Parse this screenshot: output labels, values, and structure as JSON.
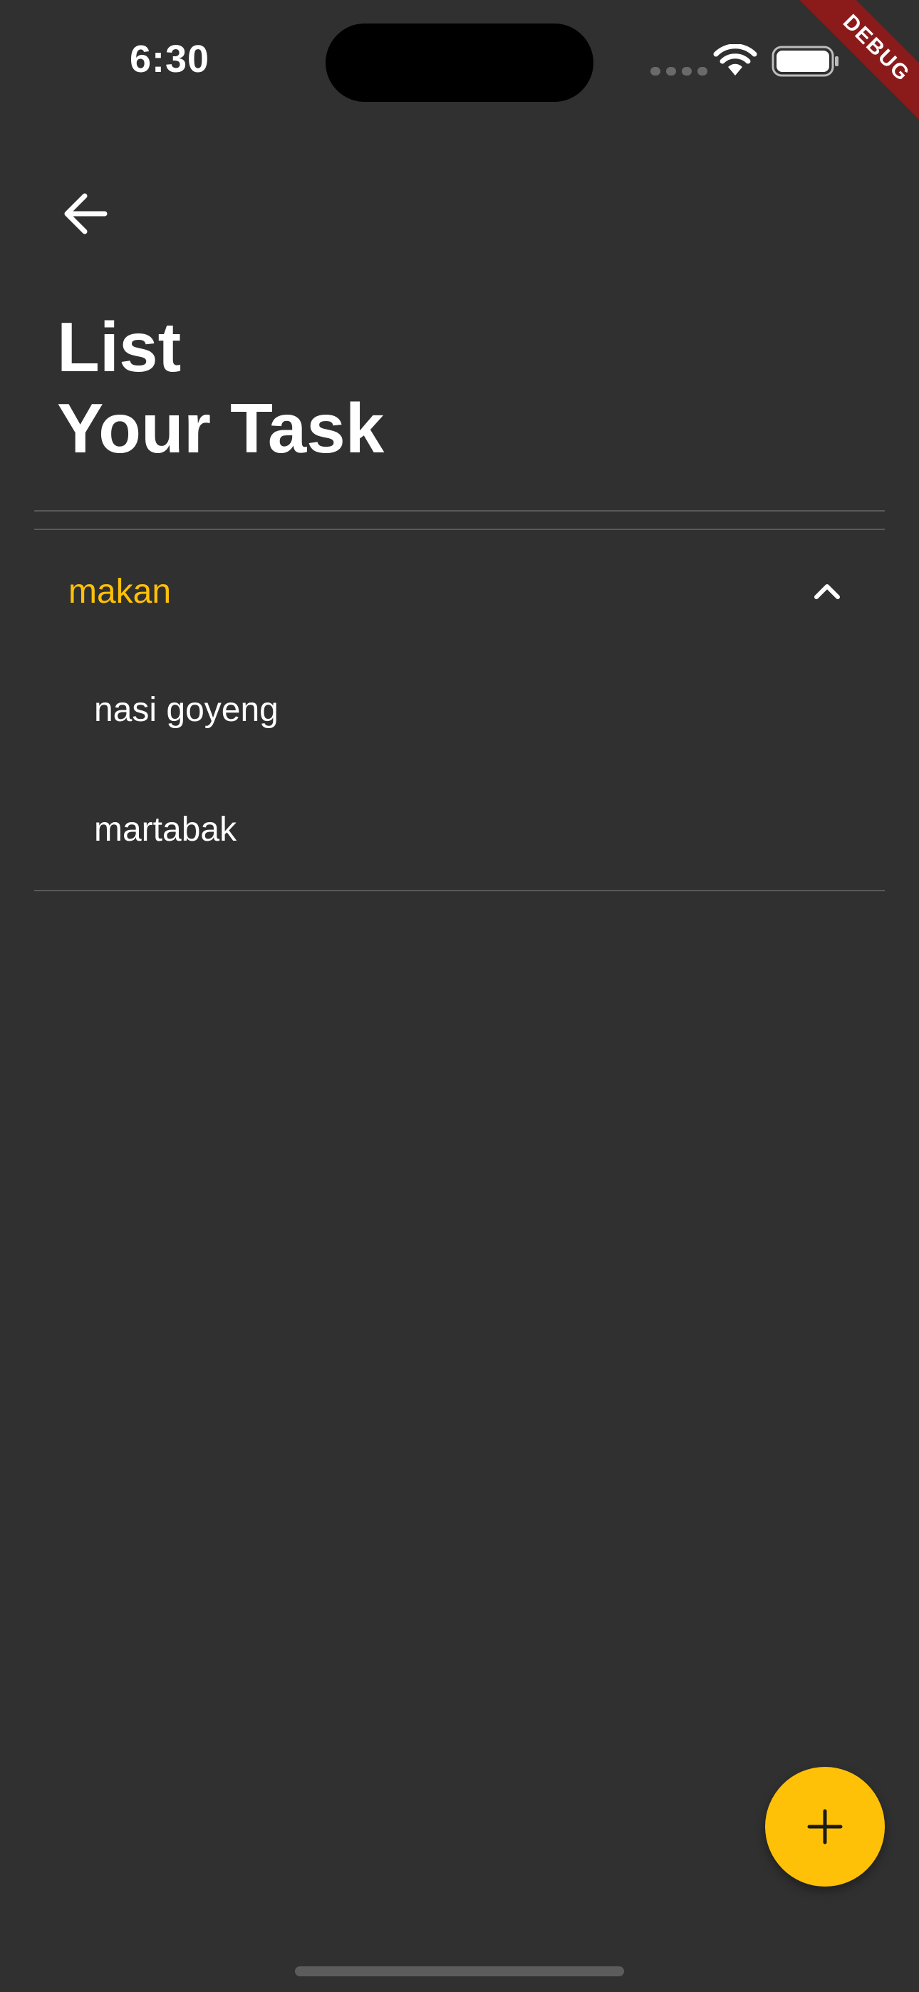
{
  "status_bar": {
    "time": "6:30"
  },
  "debug_banner": {
    "label": "DEBUG"
  },
  "header": {
    "title_line1": "List",
    "title_line2": "Your Task"
  },
  "categories": [
    {
      "name": "makan",
      "expanded": true,
      "tasks": [
        {
          "label": "nasi goyeng"
        },
        {
          "label": "martabak"
        }
      ]
    }
  ],
  "icons": {
    "back": "arrow-back-icon",
    "collapse": "chevron-up-icon",
    "add": "plus-icon"
  },
  "colors": {
    "background": "#303030",
    "accent": "#ffc107",
    "text": "#ffffff",
    "debug_ribbon": "#8b1a1a"
  }
}
